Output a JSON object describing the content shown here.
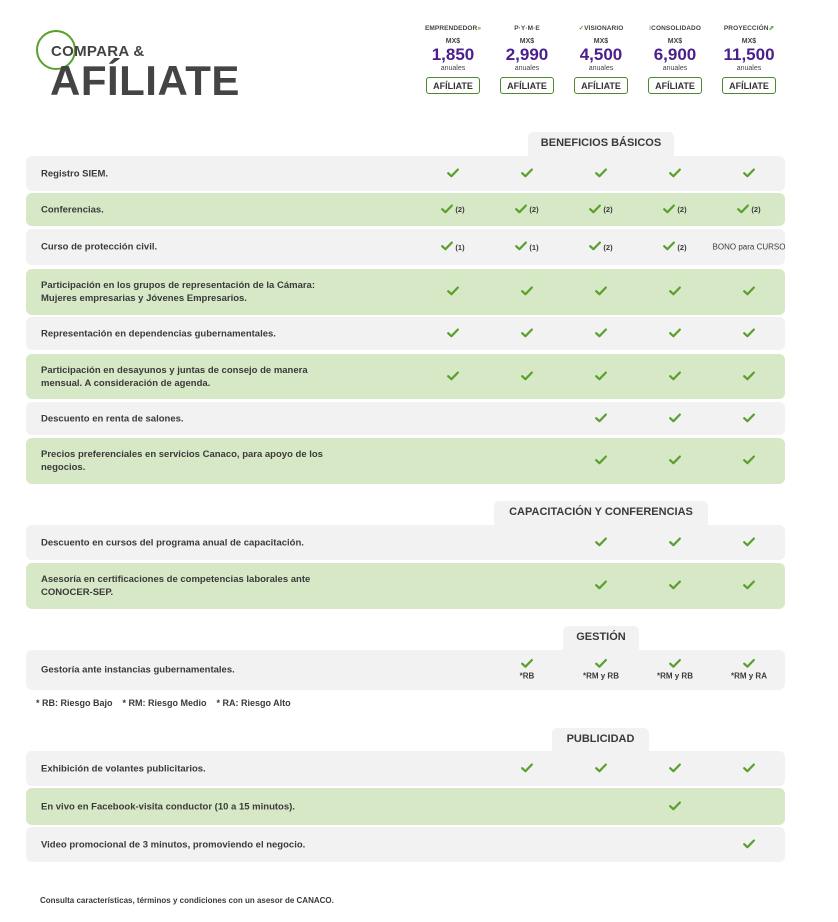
{
  "header": {
    "logo_top": "COMPARA &",
    "logo_big": "AFÍLIATE"
  },
  "plans": [
    {
      "name": "EMPRENDEDOR",
      "mark_after": "»",
      "currency": "MX$",
      "price": "1,850",
      "period": "anuales",
      "cta": "AFÍLIATE"
    },
    {
      "name": "P·Y·M·E",
      "currency": "MX$",
      "price": "2,990",
      "period": "anuales",
      "cta": "AFÍLIATE"
    },
    {
      "name": "VISIONARIO",
      "mark_before": "✓",
      "currency": "MX$",
      "price": "4,500",
      "period": "anuales",
      "cta": "AFÍLIATE"
    },
    {
      "name": "CONSOLIDADO",
      "mark_before": "⁝",
      "currency": "MX$",
      "price": "6,900",
      "period": "anuales",
      "cta": "AFÍLIATE"
    },
    {
      "name": "PROYECCIÓN",
      "mark_after": "⇗",
      "currency": "MX$",
      "price": "11,500",
      "period": "anuales",
      "cta": "AFÍLIATE"
    }
  ],
  "colors": {
    "accent_green": "#5aa02c",
    "price_purple": "#4a1f8c",
    "row_gray": "#f2f2f2",
    "row_green": "#d7e8c7"
  },
  "sections": [
    {
      "title": "BENEFICIOS BÁSICOS",
      "rows": [
        {
          "label": "Registro SIEM.",
          "cells": [
            {
              "check": true
            },
            {
              "check": true
            },
            {
              "check": true
            },
            {
              "check": true
            },
            {
              "check": true
            }
          ]
        },
        {
          "label": "Conferencias.",
          "cells": [
            {
              "check": true,
              "note": "(2)"
            },
            {
              "check": true,
              "note": "(2)"
            },
            {
              "check": true,
              "note": "(2)"
            },
            {
              "check": true,
              "note": "(2)"
            },
            {
              "check": true,
              "note": "(2)"
            }
          ]
        },
        {
          "label": "Curso de protección civil.",
          "cells": [
            {
              "check": true,
              "note": "(1)"
            },
            {
              "check": true,
              "note": "(1)"
            },
            {
              "check": true,
              "note": "(2)"
            },
            {
              "check": true,
              "note": "(2)"
            },
            {
              "text": "BONO para CURSO"
            }
          ]
        },
        {
          "label": "Participación en los grupos de representación de la Cámara: Mujeres empresarias y Jóvenes Empresarios.",
          "cells": [
            {
              "check": true
            },
            {
              "check": true
            },
            {
              "check": true
            },
            {
              "check": true
            },
            {
              "check": true
            }
          ]
        },
        {
          "label": "Representación en dependencias gubernamentales.",
          "cells": [
            {
              "check": true
            },
            {
              "check": true
            },
            {
              "check": true
            },
            {
              "check": true
            },
            {
              "check": true
            }
          ]
        },
        {
          "label": "Participación en desayunos y juntas de consejo de manera mensual. A consideración de agenda.",
          "cells": [
            {
              "check": true
            },
            {
              "check": true
            },
            {
              "check": true
            },
            {
              "check": true
            },
            {
              "check": true
            }
          ]
        },
        {
          "label": "Descuento en renta de salones.",
          "cells": [
            {},
            {},
            {
              "check": true
            },
            {
              "check": true
            },
            {
              "check": true
            }
          ]
        },
        {
          "label": "Precios preferenciales en servicios Canaco, para apoyo de los negocios.",
          "cells": [
            {},
            {},
            {
              "check": true
            },
            {
              "check": true
            },
            {
              "check": true
            }
          ]
        }
      ]
    },
    {
      "title": "CAPACITACIÓN Y CONFERENCIAS",
      "rows": [
        {
          "label": "Descuento en cursos del programa anual de capacitación.",
          "cells": [
            {},
            {},
            {
              "check": true
            },
            {
              "check": true
            },
            {
              "check": true
            }
          ]
        },
        {
          "label": "Asesoría en certificaciones de competencias laborales ante CONOCER-SEP.",
          "cells": [
            {},
            {},
            {
              "check": true
            },
            {
              "check": true
            },
            {
              "check": true
            }
          ]
        }
      ]
    },
    {
      "title": "GESTIÓN",
      "rows": [
        {
          "label": "Gestoría ante instancias gubernamentales.",
          "cells": [
            {},
            {
              "check": true,
              "sub": "*RB"
            },
            {
              "check": true,
              "sub": "*RM y RB"
            },
            {
              "check": true,
              "sub": "*RM y RB"
            },
            {
              "check": true,
              "sub": "*RM y RA"
            }
          ]
        }
      ]
    },
    {
      "title": "PUBLICIDAD",
      "rows": [
        {
          "label": "Exhibición de volantes publicitarios.",
          "cells": [
            {},
            {
              "check": true
            },
            {
              "check": true
            },
            {
              "check": true
            },
            {
              "check": true
            }
          ]
        },
        {
          "label": "En vivo en Facebook-visita conductor (10 a 15 minutos).",
          "cells": [
            {},
            {},
            {},
            {
              "check": true
            },
            {}
          ]
        },
        {
          "label": "Video promocional de 3 minutos, promoviendo el negocio.",
          "cells": [
            {},
            {},
            {},
            {},
            {
              "check": true
            }
          ]
        }
      ]
    }
  ],
  "legend": "* RB: Riesgo Bajo    * RM: Riesgo Medio    * RA: Riesgo Alto",
  "footer": "Consulta características, términos y condiciones con un asesor de CANACO."
}
